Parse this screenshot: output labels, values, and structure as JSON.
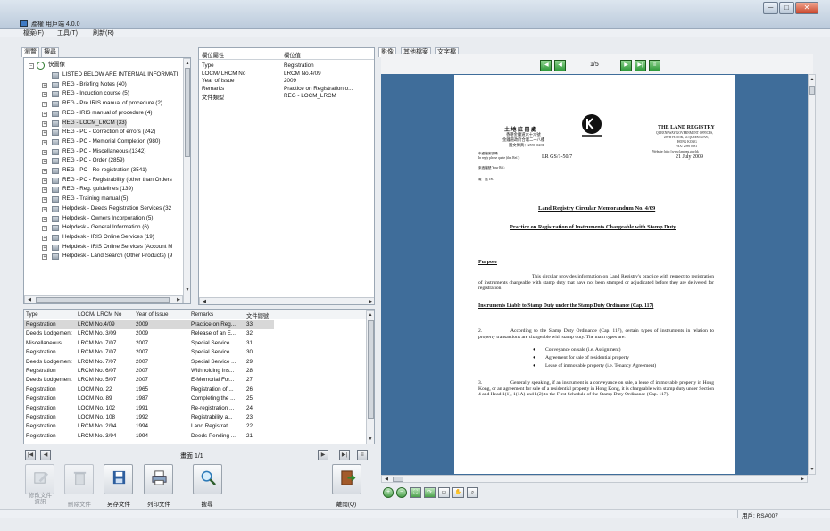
{
  "window": {
    "title": "產權 用戶端 4.0.0",
    "min": "─",
    "max": "□",
    "close": "✕"
  },
  "menu": [
    {
      "label": "檔案(F)"
    },
    {
      "label": "工具(T)"
    },
    {
      "label": "刷新(R)"
    }
  ],
  "left_tabs": [
    {
      "label": "瀏覽"
    },
    {
      "label": "搜尋"
    }
  ],
  "tree": {
    "root": "快圖像",
    "items": [
      {
        "label": "LISTED BELOW ARE INTERNAL INFORMATI"
      },
      {
        "label": "REG - Briefing Notes (40)"
      },
      {
        "label": "REG - Induction course (5)"
      },
      {
        "label": "REG - Pre IRIS manual of procedure (2)"
      },
      {
        "label": "REG - IRIS manual of procedure (4)"
      },
      {
        "label": "REG - LOCM_LRCM (33)",
        "selected": true
      },
      {
        "label": "REG - PC - Correction of errors (242)"
      },
      {
        "label": "REG - PC - Memorial Completion (980)"
      },
      {
        "label": "REG - PC - Miscellaneous (1342)"
      },
      {
        "label": "REG - PC - Order (2859)"
      },
      {
        "label": "REG - PC - Re-registration (3541)"
      },
      {
        "label": "REG - PC - Registrability (other than Orders"
      },
      {
        "label": "REG - Reg. guidelines (139)"
      },
      {
        "label": "REG - Training manual (5)"
      },
      {
        "label": "Helpdesk - Deeds Registration Services (32"
      },
      {
        "label": "Helpdesk - Owners Incorporation (5)"
      },
      {
        "label": "Helpdesk - General Information (6)"
      },
      {
        "label": "Helpdesk - IRIS Online Services (19)"
      },
      {
        "label": "Helpdesk - IRIS Online Services (Account M"
      },
      {
        "label": "Helpdesk - Land Search (Other Products) (9"
      }
    ]
  },
  "props": {
    "col1": "欄位屬性",
    "col2": "欄位值",
    "rows": [
      {
        "name": "Type",
        "value": "Registration"
      },
      {
        "name": "LOCM/ LRCM No",
        "value": "LRCM No.4/09"
      },
      {
        "name": "Year of Issue",
        "value": "2009"
      },
      {
        "name": "Remarks",
        "value": "Practice on Registration o..."
      },
      {
        "name": "文件類型",
        "value": "REG - LOCM_LRCM"
      }
    ]
  },
  "table": {
    "columns": [
      "Type",
      "LOCM/ LRCM No",
      "Year of Issue",
      "Remarks",
      "文件總號"
    ],
    "rows": [
      [
        "Registration",
        "LRCM No.4/09",
        "2009",
        "Practice on Reg...",
        "33"
      ],
      [
        "Deeds Lodgement",
        "LRCM No. 3/09",
        "2009",
        "Release of an E...",
        "32"
      ],
      [
        "Miscellaneous",
        "LRCM No. 7/07",
        "2007",
        "Special Service ...",
        "31"
      ],
      [
        "Registration",
        "LRCM No. 7/07",
        "2007",
        "Special Service ...",
        "30"
      ],
      [
        "Deeds Lodgement",
        "LRCM No. 7/07",
        "2007",
        "Special Service ...",
        "29"
      ],
      [
        "Registration",
        "LRCM No. 6/07",
        "2007",
        "Withholding Ins...",
        "28"
      ],
      [
        "Deeds Lodgement",
        "LRCM No. 5/07",
        "2007",
        "E-Memorial For...",
        "27"
      ],
      [
        "Registration",
        "LOCM No. 22",
        "1965",
        "Registration of ...",
        "26"
      ],
      [
        "Registration",
        "LOCM No. 89",
        "1987",
        "Completing the ...",
        "25"
      ],
      [
        "Registration",
        "LOCM No. 102",
        "1991",
        "Re-registration ...",
        "24"
      ],
      [
        "Registration",
        "LOCM No. 108",
        "1992",
        "Registrability a...",
        "23"
      ],
      [
        "Registration",
        "LRCM No. 2/94",
        "1994",
        "Land Registrati...",
        "22"
      ],
      [
        "Registration",
        "LRCM No. 3/94",
        "1994",
        "Deeds Pending ...",
        "21"
      ]
    ],
    "selected_row": 0
  },
  "pager": {
    "label": "畫面 1/1"
  },
  "actions": [
    {
      "label": "修改文件\n資訊",
      "icon": "edit-icon",
      "enabled": false
    },
    {
      "label": "刪除文件",
      "icon": "trash-icon",
      "enabled": false
    },
    {
      "label": "另存文件",
      "icon": "save-icon",
      "enabled": true
    },
    {
      "label": "列印文件",
      "icon": "print-icon",
      "enabled": true
    },
    {
      "label": "搜尋",
      "icon": "search-icon",
      "enabled": true
    },
    {
      "label": "離開(Q)",
      "icon": "exit-icon",
      "enabled": true
    }
  ],
  "viewer_tabs": [
    {
      "label": "影像"
    },
    {
      "label": "其他檔案"
    },
    {
      "label": "文字檔"
    }
  ],
  "viewer": {
    "page_label": "1/5"
  },
  "doc": {
    "cn_head": "土 地 註 冊 處",
    "cn_addr1": "香港金鐘道六十六號",
    "cn_addr2": "金鐘道政府合署二十八樓",
    "cn_addr3": "圖文傳真：2596 0281",
    "en_head": "THE LAND REGISTRY",
    "en_addr1": "QUEENSWAY GOVERNMENT OFFICES,",
    "en_addr2": "28TH FLOOR, 66 QUEENSWAY,",
    "en_addr3": "HONG KONG",
    "en_fax": "FAX: 2596 0281",
    "en_web": "Website: http://www.landreg.gov.hk",
    "ref_cn": "本處檔案號碼",
    "ref_label": "In reply please quote (this Ref.):",
    "ref_no": "LR GS/1-50/7",
    "date": "21 July 2009",
    "your_ref": "來函檔號 Your Ref.:",
    "tel": "電　話 Tel.:",
    "title1": "Land Registry Circular Memorandum No. 4/09",
    "title2": "Practice on Registration of Instruments Chargeable with Stamp Duty",
    "h_purpose": "Purpose",
    "p1": "This circular provides information on Land Registry's practice with respect to registration of instruments chargeable with stamp duty that have not been stamped or adjudicated before they are delivered for registration.",
    "h2": "Instruments Liable to Stamp Duty under the Stamp Duty Ordinance (Cap. 117)",
    "p2_num": "2.",
    "p2": "According to the Stamp Duty Ordinance (Cap. 117), certain types of instruments in relation to property transactions are chargeable with stamp duty. The main types are:",
    "b1": "Conveyance on sale (i.e. Assignment)",
    "b2": "Agreement for sale of residential property",
    "b3": "Lease of immovable property (i.e. Tenancy Agreement)",
    "p3_num": "3.",
    "p3": "Generally speaking, if an instrument is a conveyance on sale, a lease of immovable property in Hong Kong, or an agreement for sale of a residential property in Hong Kong, it is chargeable with stamp duty under Section 4 and Head 1(1), 1(1A) and 1(2) to the First Schedule of the Stamp Duty Ordinance (Cap. 117)."
  },
  "status": {
    "user": "用戶: RSA007"
  }
}
